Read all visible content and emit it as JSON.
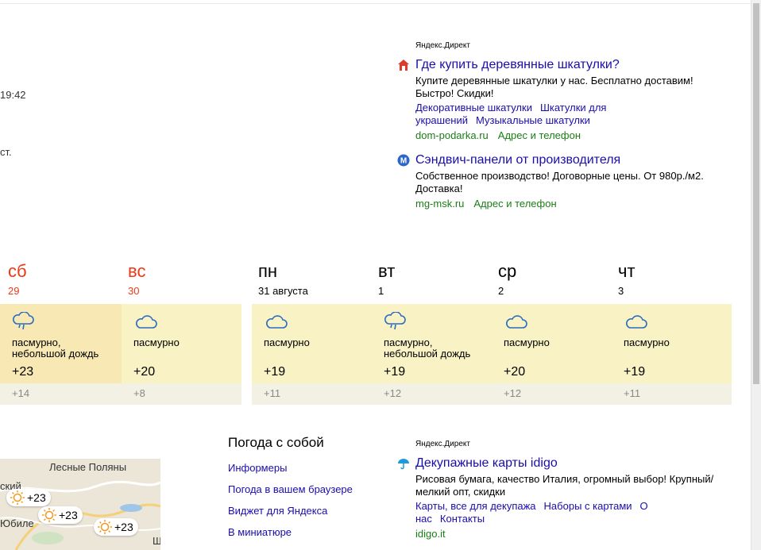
{
  "left_fragments": {
    "time": "19:42",
    "text": "ст."
  },
  "direct": {
    "label_top": "Яндекс.Директ",
    "label_bottom": "Яндекс.Директ"
  },
  "ads": [
    {
      "icon": "house-icon",
      "title": "Где купить деревянные шкатулки?",
      "desc": "Купите деревянные шкатулки у нас. Бесплатно доставим! Быстро! Скидки!",
      "links": [
        "Декоративные шкатулки",
        "Шкатулки для украшений",
        "Музыкальные шкатулки"
      ],
      "domain": "dom-podarka.ru",
      "address": "Адрес и телефон"
    },
    {
      "icon": "metro-icon",
      "title": "Сэндвич-панели от производителя",
      "desc": "Собственное производство! Договорные цены. От 980р./м2. Доставка!",
      "domain": "mg-msk.ru",
      "address": "Адрес и телефон"
    },
    {
      "icon": "umbrella-icon",
      "title": "Декупажные карты idigo",
      "desc": "Рисовая бумага, качество Италия, огромный выбор! Крупный/мелкий опт, скидки",
      "links": [
        "Карты, все для декупажа",
        "Наборы с картами",
        "О нас",
        "Контакты"
      ],
      "domain": "idigo.it"
    }
  ],
  "forecast": [
    {
      "day": "сб",
      "date": "29",
      "weekend": true,
      "icon": "cloud-rain-icon",
      "cond": [
        "пасмурно,",
        "небольшой дождь"
      ],
      "day_t": "+23",
      "night_t": "+14",
      "today": true
    },
    {
      "day": "вс",
      "date": "30",
      "weekend": true,
      "icon": "cloud-icon",
      "cond": [
        "пасмурно"
      ],
      "day_t": "+20",
      "night_t": "+8"
    },
    {
      "day": "пн",
      "date": "31 августа",
      "weekend": false,
      "icon": "cloud-icon",
      "cond": [
        "пасмурно"
      ],
      "day_t": "+19",
      "night_t": "+11"
    },
    {
      "day": "вт",
      "date": "1",
      "weekend": false,
      "icon": "cloud-rain-icon",
      "cond": [
        "пасмурно,",
        "небольшой дождь"
      ],
      "day_t": "+19",
      "night_t": "+12"
    },
    {
      "day": "ср",
      "date": "2",
      "weekend": false,
      "icon": "cloud-icon",
      "cond": [
        "пасмурно"
      ],
      "day_t": "+20",
      "night_t": "+12"
    },
    {
      "day": "чт",
      "date": "3",
      "weekend": false,
      "icon": "cloud-icon",
      "cond": [
        "пасмурно"
      ],
      "day_t": "+19",
      "night_t": "+11"
    }
  ],
  "map": {
    "labels": [
      "Лесные Поляны",
      "ский",
      "Юбиле",
      "Щ"
    ],
    "pins": [
      "+23",
      "+23",
      "+23"
    ]
  },
  "pogoda": {
    "title": "Погода с собой",
    "links": [
      "Информеры",
      "Погода в вашем браузере",
      "Виджет для Яндекса",
      "В миниатюре"
    ]
  },
  "colors": {
    "link": "#1a0dab",
    "domain": "#1a7e16",
    "weekend": "#ea3a18",
    "day_bg": "#f9f2c5",
    "night_bg": "#f3f1e4"
  }
}
